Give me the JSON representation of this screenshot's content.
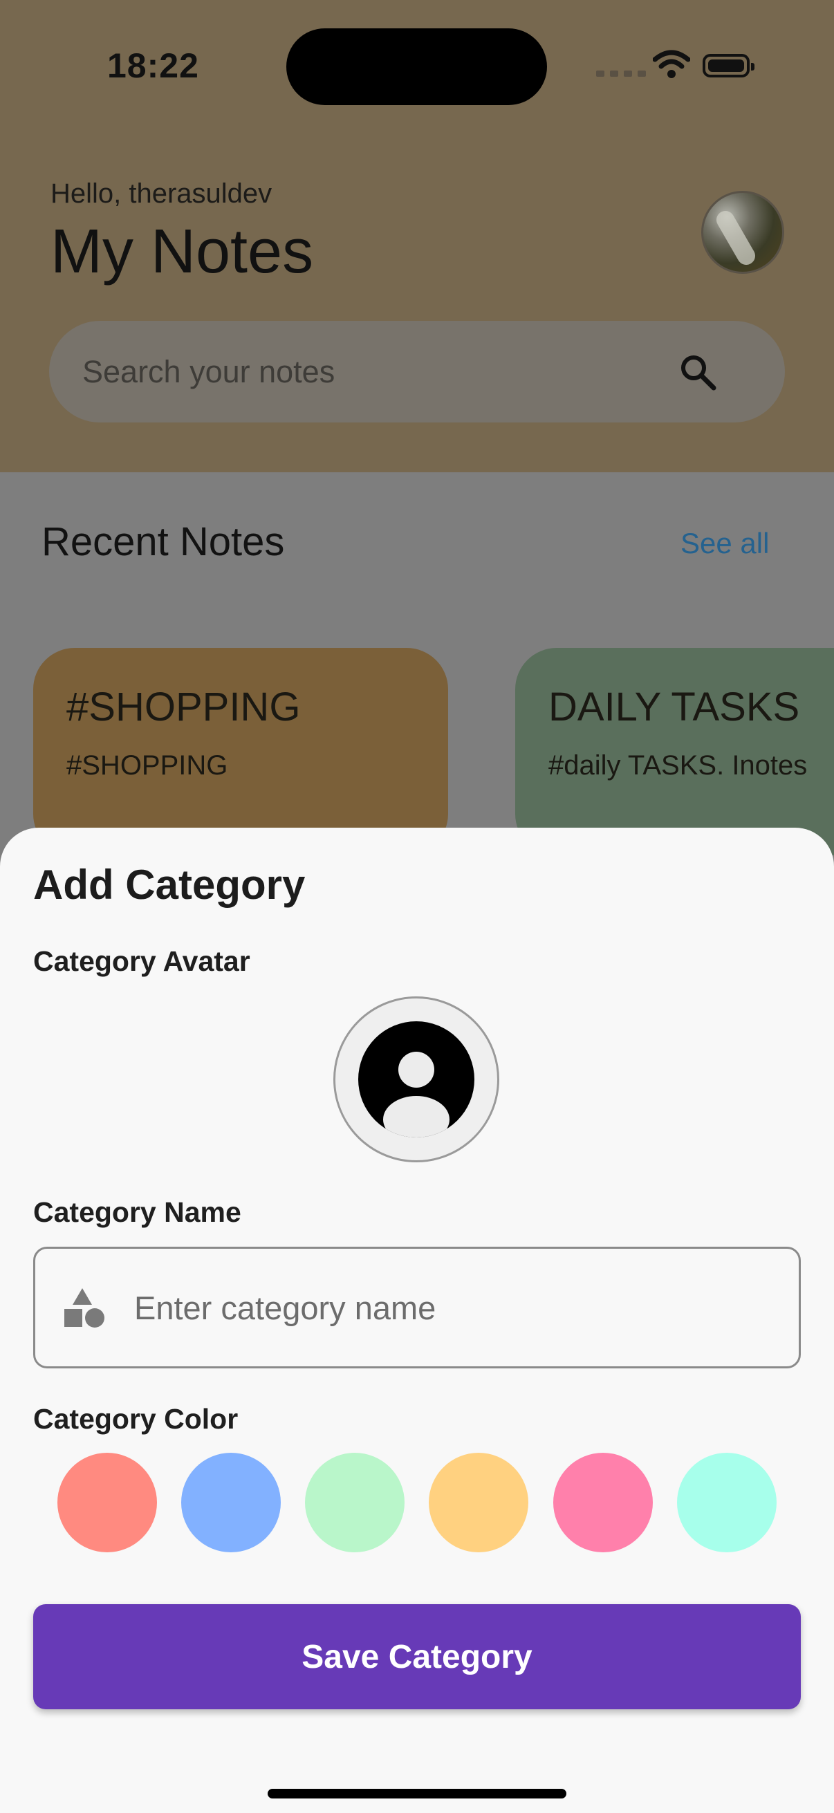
{
  "status_bar": {
    "time": "18:22"
  },
  "header": {
    "greeting": "Hello, therasuldev",
    "title": "My Notes",
    "search": {
      "placeholder": "Search your notes",
      "value": ""
    }
  },
  "recent": {
    "title": "Recent Notes",
    "see_all": "See all",
    "notes": [
      {
        "title": "#SHOPPING",
        "subtitle": "#SHOPPING",
        "color": "#7b6039"
      },
      {
        "title": "DAILY TASKS",
        "subtitle": "#daily TASKS. Inotes",
        "color": "#5a6f5c"
      }
    ]
  },
  "sheet": {
    "title": "Add Category",
    "avatar_label": "Category Avatar",
    "name_label": "Category Name",
    "name_placeholder": "Enter category name",
    "name_value": "",
    "color_label": "Category Color",
    "colors": [
      "#ff8a80",
      "#82b1ff",
      "#b9f6ca",
      "#ffd180",
      "#ff80ab",
      "#a7ffeb"
    ],
    "save_label": "Save Category",
    "save_color": "#673ab7"
  }
}
